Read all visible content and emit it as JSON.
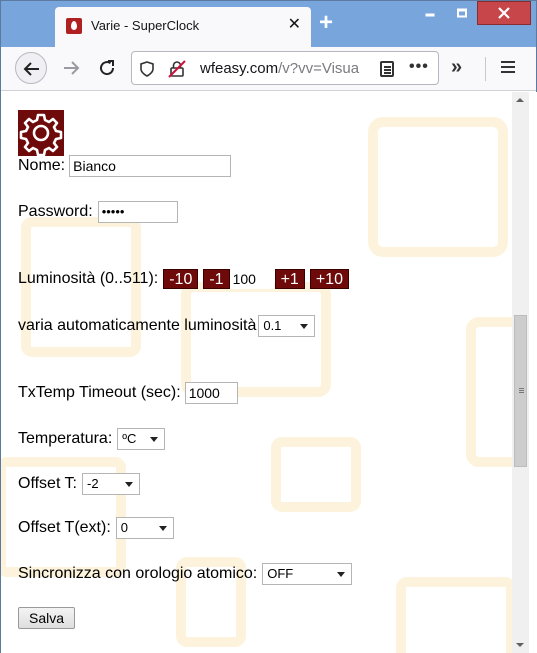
{
  "browser": {
    "tab_title": "Varie - SuperClock",
    "tab_close": "✕",
    "new_tab": "+",
    "url_domain": "wfeasy.com",
    "url_path": "/v?vv=Visua",
    "more_label": "•••",
    "overflow_label": "»"
  },
  "form": {
    "name_label": "Nome:",
    "name_value": "Bianco",
    "password_label": "Password:",
    "password_value": "•••••",
    "brightness_label": "Luminosità (0..511):",
    "btn_minus10": "-10",
    "btn_minus1": "-1",
    "brightness_value": "100",
    "btn_plus1": "+1",
    "btn_plus10": "+10",
    "auto_brightness_label": "varia automaticamente luminosità",
    "auto_brightness_value": "0.1",
    "txtemp_label": "TxTemp Timeout (sec):",
    "txtemp_value": "1000",
    "temperature_label": "Temperatura:",
    "temperature_value": "ºC",
    "offset_t_label": "Offset T:",
    "offset_t_value": "-2",
    "offset_t_ext_label": "Offset T(ext):",
    "offset_t_ext_value": "0",
    "sync_label": "Sincronizza con orologio atomico:",
    "sync_value": "OFF",
    "save_label": "Salva"
  },
  "colors": {
    "accent": "#6e0a0a",
    "titlebar": "#78a6dc",
    "decoration": "#fdf3dc"
  },
  "icons": [
    "flame-favicon-icon",
    "back-arrow-icon",
    "forward-arrow-icon",
    "reload-icon",
    "shield-icon",
    "tracking-lock-icon",
    "reader-view-icon",
    "more-icon",
    "overflow-icon",
    "hamburger-menu-icon",
    "gear-icon"
  ]
}
